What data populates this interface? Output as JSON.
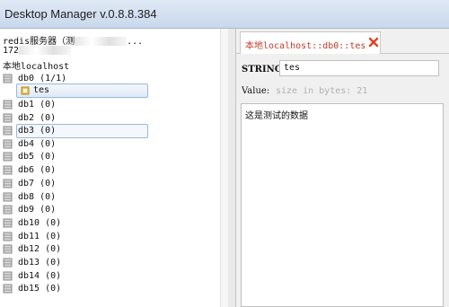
{
  "window": {
    "title": "Desktop Manager v.0.8.8.384"
  },
  "tree": {
    "connection_label": "redis服务器（测",
    "connection_ellipsis": "...",
    "host_partial": "172",
    "localhost_label": "本地localhost",
    "databases": [
      {
        "label": "db0  (1/1)"
      },
      {
        "label": "db1 (0)"
      },
      {
        "label": "db2 (0)"
      },
      {
        "label": "db3 (0)"
      },
      {
        "label": "db4 (0)"
      },
      {
        "label": "db5 (0)"
      },
      {
        "label": "db6 (0)"
      },
      {
        "label": "db7 (0)"
      },
      {
        "label": "db8 (0)"
      },
      {
        "label": "db9 (0)"
      },
      {
        "label": "db10 (0)"
      },
      {
        "label": "db11 (0)"
      },
      {
        "label": "db12 (0)"
      },
      {
        "label": "db13 (0)"
      },
      {
        "label": "db14 (0)"
      },
      {
        "label": "db15 (0)"
      }
    ],
    "key_node": "tes"
  },
  "tab": {
    "label": "本地localhost::db0::tes",
    "close_icon": "close-icon",
    "close_color": "#e0401c"
  },
  "editor": {
    "type_label": "STRING:",
    "key_value": "tes",
    "value_label": "Value:",
    "size_hint": "size in bytes: 21",
    "value_text": "这是测试的数据"
  },
  "colors": {
    "tab_text": "#c0392b",
    "selection_border": "#9ab6dc"
  }
}
